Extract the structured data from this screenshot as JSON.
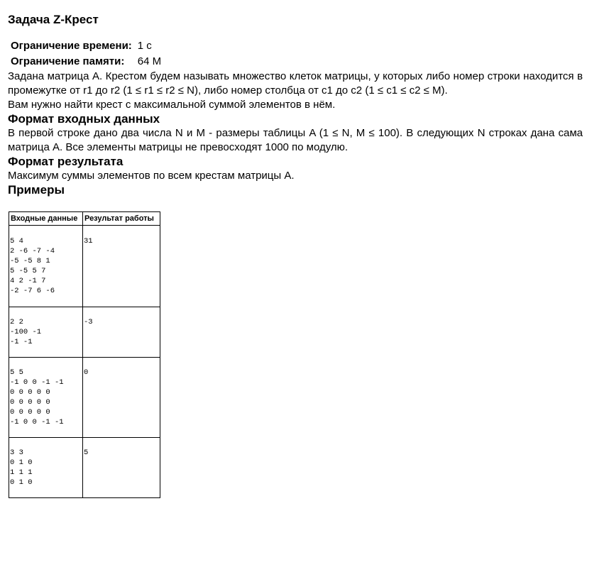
{
  "problem": {
    "title": "Задача Z-Крест"
  },
  "limits": {
    "time_label": "Ограничение времени:",
    "time_value": "1 с",
    "memory_label": "Ограничение памяти:",
    "memory_value": "64 M"
  },
  "legend": {
    "description": "Задана матрица A. Крестом будем называть множество клеток матрицы, у которых либо номер строки находится в промежутке от r1 до r2 (1 ≤ r1 ≤ r2 ≤ N), либо номер столбца от c1 до c2 (1 ≤ c1 ≤ c2 ≤ M).",
    "task": "Вам нужно найти крест с максимальной суммой элементов в нём."
  },
  "input_format": {
    "heading": "Формат входных данных",
    "text": "В первой строке дано два числа N и M - размеры таблицы A (1 ≤ N, M ≤ 100). В следующих N строках дана сама матрица A. Все элементы матрицы не превосходят 1000 по модулю."
  },
  "output_format": {
    "heading": "Формат результата",
    "text": "Максимум суммы элементов по всем крестам матрицы A."
  },
  "examples": {
    "heading": "Примеры",
    "col_input": "Входные данные",
    "col_output": "Результат работы",
    "rows": [
      {
        "input": "5 4\n2 -6 -7 -4\n-5 -5 8 1\n5 -5 5 7\n4 2 -1 7\n-2 -7 6 -6",
        "output": "31"
      },
      {
        "input": "2 2\n-100 -1\n-1 -1",
        "output": "-3"
      },
      {
        "input": "5 5\n-1 0 0 -1 -1\n0 0 0 0 0\n0 0 0 0 0\n0 0 0 0 0\n-1 0 0 -1 -1",
        "output": "0"
      },
      {
        "input": "3 3\n0 1 0\n1 1 1\n0 1 0",
        "output": "5"
      }
    ]
  }
}
